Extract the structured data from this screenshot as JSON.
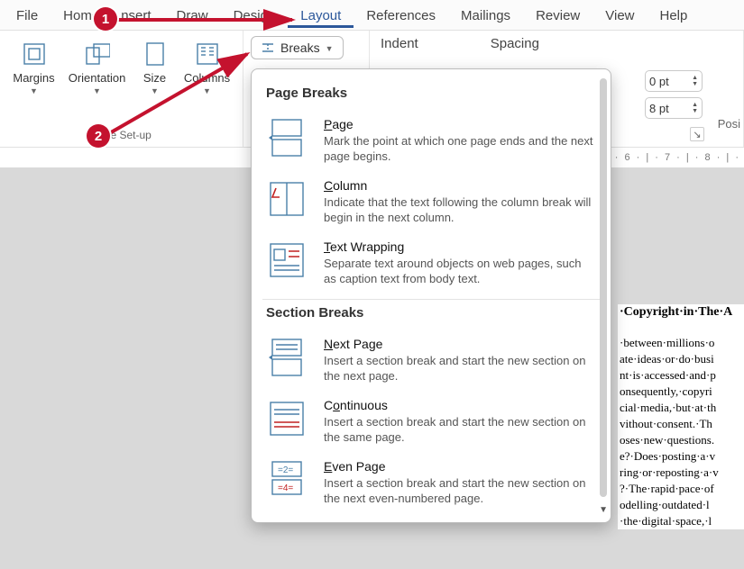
{
  "tabs": {
    "file": "File",
    "home": "Home",
    "insert": "nsert",
    "draw": "Draw",
    "design": "Design",
    "layout": "Layout",
    "references": "References",
    "mailings": "Mailings",
    "review": "Review",
    "view": "View",
    "help": "Help"
  },
  "ribbon": {
    "margins": "Margins",
    "orientation": "Orientation",
    "size": "Size",
    "columns": "Columns",
    "page_setup_label": "Page Set-up",
    "breaks_label": "Breaks",
    "indent_label": "Indent",
    "spacing_label": "Spacing",
    "posi_label": "Posi",
    "pt_before": "0 pt",
    "pt_after": "8 pt"
  },
  "ruler": "· · 6 · | · 7 · | · 8 · | ·",
  "dropdown": {
    "page_breaks_header": "Page Breaks",
    "section_breaks_header": "Section Breaks",
    "items": [
      {
        "title": "Page",
        "u": "P",
        "desc": "Mark the point at which one page ends and the next page begins."
      },
      {
        "title": "Column",
        "u": "C",
        "desc": "Indicate that the text following the column break will begin in the next column."
      },
      {
        "title": "Text Wrapping",
        "u": "T",
        "desc": "Separate text around objects on web pages, such as caption text from body text."
      },
      {
        "title": "Next Page",
        "u": "N",
        "desc": "Insert a section break and start the new section on the next page."
      },
      {
        "title": "Continuous",
        "u": "o",
        "desc": "Insert a section break and start the new section on the same page."
      },
      {
        "title": "Even Page",
        "u": "E",
        "desc": "Insert a section break and start the new section on the next even-numbered page."
      }
    ]
  },
  "document": {
    "heading": "·Copyright·in·The·A",
    "lines": [
      "·between·millions·o",
      "ate·ideas·or·do·busi",
      "nt·is·accessed·and·p",
      "onsequently,·copyri",
      "cial·media,·but·at·th",
      "vithout·consent.·Th",
      "oses·new·questions.",
      "e?·Does·posting·a·v",
      "ring·or·reposting·a·v",
      "?·The·rapid·pace·of",
      "odelling·outdated·l",
      "·the·digital·space,·l"
    ]
  },
  "annotations": {
    "badge1": "1",
    "badge2": "2"
  }
}
